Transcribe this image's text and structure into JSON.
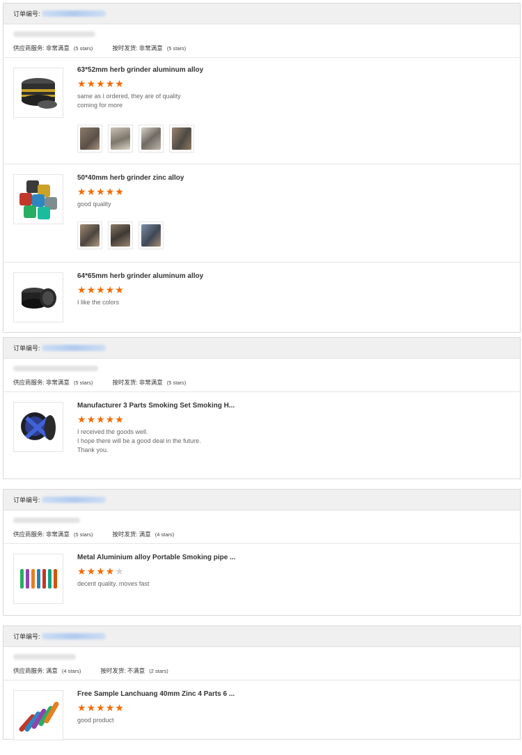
{
  "order_label": "订单编号:",
  "supplier_label": "供应商服务:",
  "shipping_label": "按时发货:",
  "orders": [
    {
      "supplier_value": "非常满意",
      "supplier_stars": "(5 stars)",
      "shipping_value": "非常满意",
      "shipping_stars": "(5 stars)",
      "items": [
        {
          "title": "63*52mm herb grinder aluminum alloy",
          "rating": 5,
          "review": [
            "same as I ordered, they are of quality",
            "coming for more"
          ],
          "photos": 4
        },
        {
          "title": "50*40mm herb grinder zinc alloy",
          "rating": 5,
          "review": [
            "good quality"
          ],
          "photos": 3
        },
        {
          "title": "64*65mm herb grinder aluminum alloy",
          "rating": 5,
          "review": [
            "I like the colors"
          ],
          "photos": 0
        }
      ]
    },
    {
      "supplier_value": "非常满意",
      "supplier_stars": "(5 stars)",
      "shipping_value": "非常满意",
      "shipping_stars": "(5 stars)",
      "items": [
        {
          "title": "Manufacturer 3 Parts Smoking Set Smoking H...",
          "rating": 5,
          "review": [
            "I received the goods well.",
            "I hope there will be a good deal in the future.",
            "Thank you."
          ],
          "photos": 0
        }
      ]
    },
    {
      "supplier_value": "非常满意",
      "supplier_stars": "(5 stars)",
      "shipping_value": "满意",
      "shipping_stars": "(4 stars)",
      "items": [
        {
          "title": "Metal Aluminium alloy Portable Smoking pipe ...",
          "rating": 4,
          "review": [
            "decent quality. moves fast"
          ],
          "photos": 0
        }
      ]
    },
    {
      "supplier_value": "满意",
      "supplier_stars": "(4 stars)",
      "shipping_value": "不满意",
      "shipping_stars": "(2 stars)",
      "items": [
        {
          "title": "Free Sample Lanchuang 40mm Zinc 4 Parts 6 ...",
          "rating": 5,
          "review": [
            "good product"
          ],
          "photos": 0
        }
      ]
    }
  ],
  "colors": {
    "star_on": "#f56a00",
    "star_off": "#d0d0d0",
    "header_bg": "#f0f0f0"
  },
  "icons": {
    "star": "star-icon"
  }
}
